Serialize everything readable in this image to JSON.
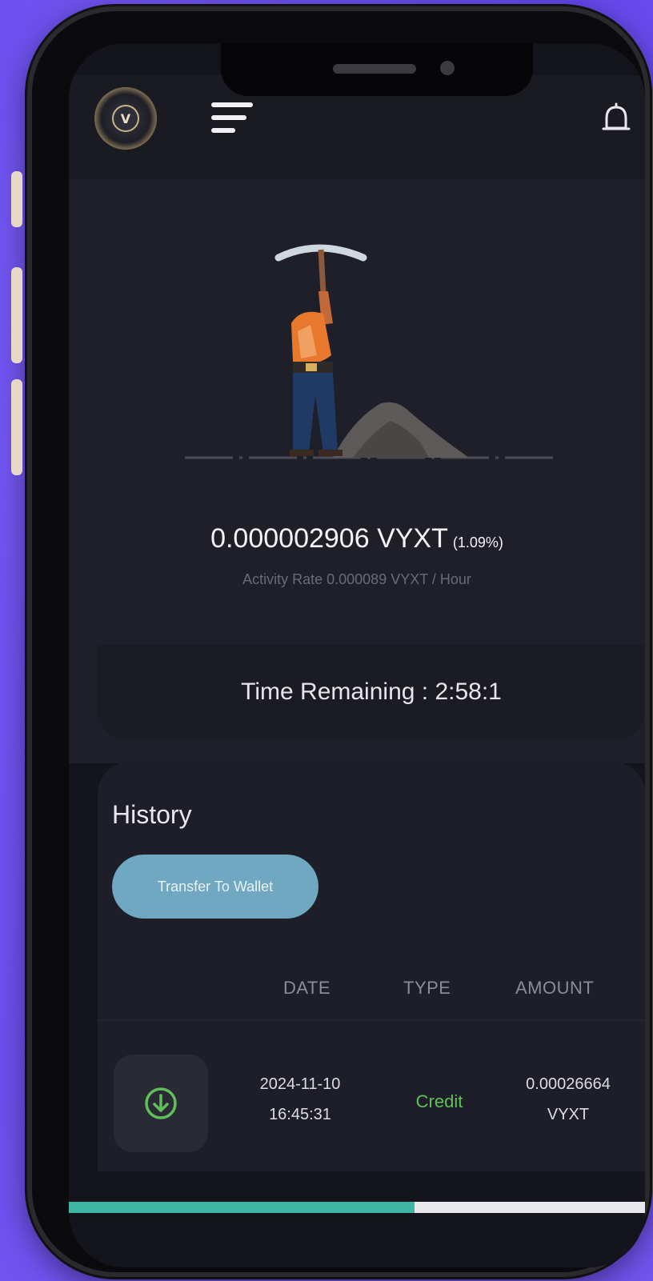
{
  "app": {
    "logo_letter": "V"
  },
  "mining": {
    "balance": "0.000002906 VYXT",
    "percent": "(1.09%)",
    "rate": "Activity Rate 0.000089 VYXT / Hour",
    "time_remaining": "Time Remaining : 2:58:1"
  },
  "history": {
    "title": "History",
    "transfer_label": "Transfer To Wallet",
    "columns": [
      "DATE",
      "TYPE",
      "AMOUNT"
    ],
    "rows": [
      {
        "date": "2024-11-10",
        "time": "16:45:31",
        "type": "Credit",
        "amount": "0.00026664",
        "unit": "VYXT",
        "icon": "download-circle-icon"
      }
    ]
  },
  "progress": {
    "fraction": 0.6
  },
  "colors": {
    "accent": "#6fa8c0",
    "credit": "#5fbf5a",
    "progress": "#3fb5a4",
    "background": "#14151c"
  }
}
